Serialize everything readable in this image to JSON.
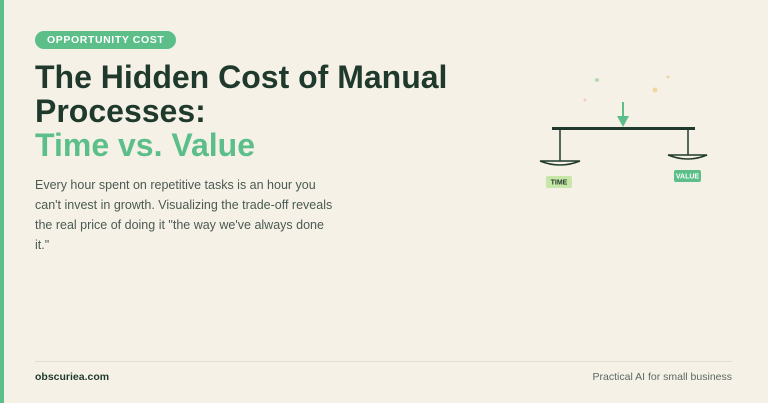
{
  "colors": {
    "background": "#f6f1e7",
    "accent": "#5cbf8a",
    "heading": "#1f3a2c",
    "body_text": "#4a5a52",
    "time_tag": "#c8e6a8",
    "value_tag": "#5cbf8a"
  },
  "badge": {
    "label": "OPPORTUNITY COST"
  },
  "headline": {
    "line1": "The Hidden Cost of Manual",
    "line2": "Processes:",
    "line3": "Time vs. Value"
  },
  "description": "Every hour spent on repetitive tasks is an hour you can't invest in growth. Visualizing the trade-off reveals the real price of doing it \"the way we've always done it.\"",
  "illustration": {
    "type": "balance-scale",
    "left_label": "TIME",
    "right_label": "VALUE",
    "arrow_direction": "down"
  },
  "footer": {
    "site": "obscuriea.com",
    "tagline": "Practical AI for small business"
  }
}
